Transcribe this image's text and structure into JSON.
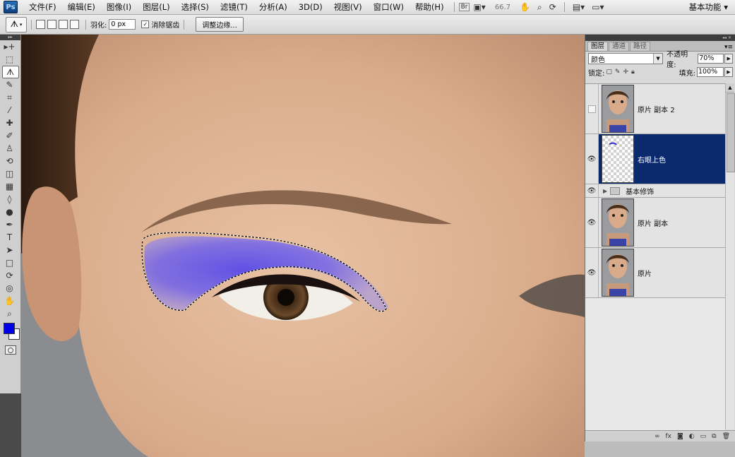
{
  "menubar": {
    "app_logo": "Ps",
    "items": [
      "文件(F)",
      "编辑(E)",
      "图像(I)",
      "图层(L)",
      "选择(S)",
      "滤镜(T)",
      "分析(A)",
      "3D(D)",
      "视图(V)",
      "窗口(W)",
      "帮助(H)"
    ],
    "bridge": "Br",
    "zoom": "66.7",
    "workspace": "基本功能"
  },
  "options": {
    "feather_label": "羽化:",
    "feather_value": "0 px",
    "antialias_label": "消除锯齿",
    "antialias_checked": true,
    "refine_edge": "调整边缘..."
  },
  "tools": [
    {
      "name": "move-tool",
      "glyph": "▸+"
    },
    {
      "name": "marquee-tool",
      "glyph": "⬚"
    },
    {
      "name": "lasso-tool",
      "glyph": "ᗑ",
      "active": true
    },
    {
      "name": "quick-select-tool",
      "glyph": "✎"
    },
    {
      "name": "crop-tool",
      "glyph": "⌗"
    },
    {
      "name": "eyedropper-tool",
      "glyph": "⁄"
    },
    {
      "name": "healing-tool",
      "glyph": "✚"
    },
    {
      "name": "brush-tool",
      "glyph": "✐"
    },
    {
      "name": "clone-stamp-tool",
      "glyph": "♙"
    },
    {
      "name": "history-brush-tool",
      "glyph": "⟲"
    },
    {
      "name": "eraser-tool",
      "glyph": "◫"
    },
    {
      "name": "gradient-tool",
      "glyph": "▦"
    },
    {
      "name": "blur-tool",
      "glyph": "◊"
    },
    {
      "name": "dodge-tool",
      "glyph": "●"
    },
    {
      "name": "pen-tool",
      "glyph": "✒"
    },
    {
      "name": "type-tool",
      "glyph": "T"
    },
    {
      "name": "path-select-tool",
      "glyph": "➤"
    },
    {
      "name": "shape-tool",
      "glyph": "□"
    },
    {
      "name": "3d-rotate-tool",
      "glyph": "⟳"
    },
    {
      "name": "3d-orbit-tool",
      "glyph": "◎"
    },
    {
      "name": "hand-tool",
      "glyph": "✋"
    },
    {
      "name": "zoom-tool",
      "glyph": "⌕"
    }
  ],
  "colors": {
    "foreground": "#0000e6",
    "background": "#ffffff",
    "selected_layer": "#0b2a6e"
  },
  "layers_panel": {
    "tabs": [
      "图层",
      "通道",
      "路径"
    ],
    "blend_mode": "颜色",
    "opacity_label": "不透明度:",
    "opacity_value": "70%",
    "lock_label": "锁定:",
    "fill_label": "填充:",
    "fill_value": "100%",
    "layers": [
      {
        "name": "原片 副本 2",
        "visible": false,
        "type": "photo",
        "selected": false
      },
      {
        "name": "右眼上色",
        "visible": true,
        "type": "empty",
        "selected": true
      },
      {
        "name": "基本修饰",
        "visible": true,
        "type": "group",
        "selected": false
      },
      {
        "name": "原片 副本",
        "visible": true,
        "type": "photo",
        "selected": false
      },
      {
        "name": "原片",
        "visible": true,
        "type": "photo",
        "selected": false
      }
    ]
  }
}
